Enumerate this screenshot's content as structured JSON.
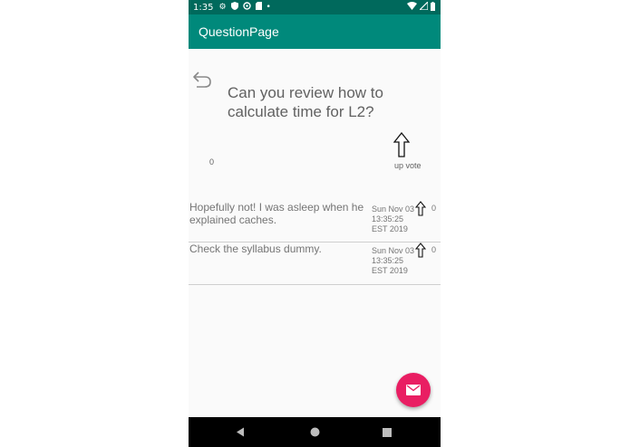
{
  "status_bar": {
    "time": "1:35",
    "icons": [
      "settings-icon",
      "shield-icon",
      "sync-icon",
      "sd-card-icon",
      "dot-icon"
    ],
    "right_icons": [
      "wifi-icon",
      "signal-icon",
      "battery-icon"
    ]
  },
  "app_bar": {
    "title": "QuestionPage"
  },
  "question": {
    "text": "Can you review how to calculate time for L2?",
    "votes": "0",
    "upvote_label": "up vote"
  },
  "answers": [
    {
      "text": "Hopefully not! I was asleep when he explained caches.",
      "date": "Sun Nov 03 13:35:25 EST 2019",
      "votes": "0"
    },
    {
      "text": "Check the syllabus dummy.",
      "date": "Sun Nov 03 13:35:25 EST 2019",
      "votes": "0"
    }
  ],
  "fab": {
    "icon": "mail-icon",
    "color": "#e91e63"
  },
  "colors": {
    "status_bar": "#00695c",
    "app_bar": "#00897b",
    "background": "#fafafa",
    "accent": "#e91e63"
  },
  "nav_bar": {
    "icons": [
      "back-nav-icon",
      "home-nav-icon",
      "recents-nav-icon"
    ]
  }
}
